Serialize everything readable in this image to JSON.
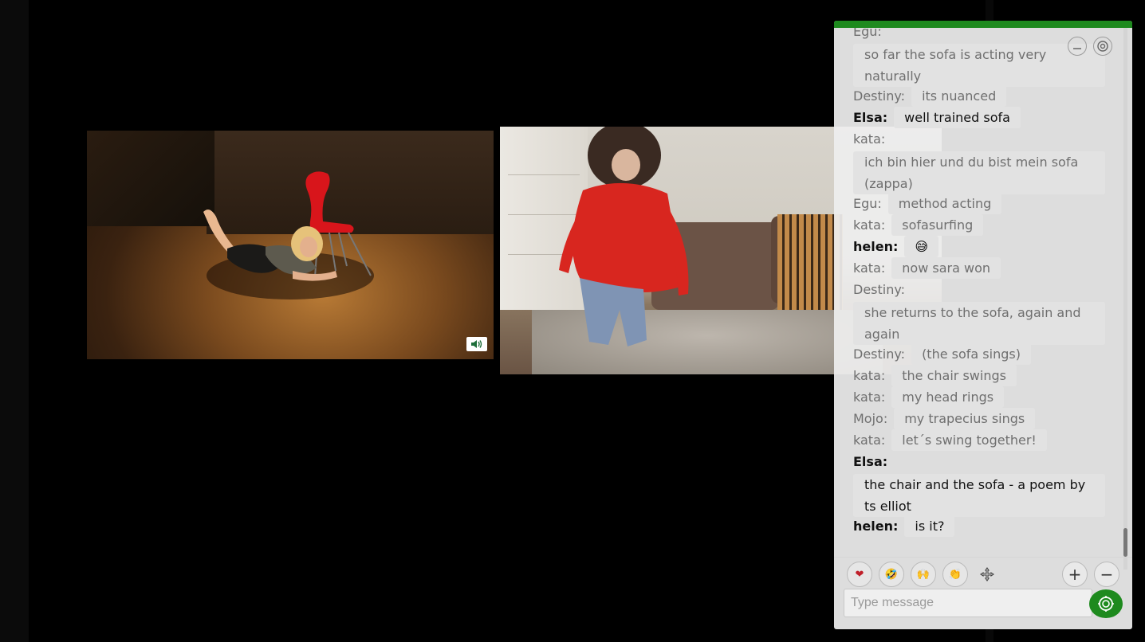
{
  "chat": {
    "messages": [
      {
        "user": "Egu:",
        "text": "so far the sofa is acting very naturally",
        "bold": false
      },
      {
        "user": "Destiny:",
        "text": "its nuanced",
        "bold": false
      },
      {
        "user": "Elsa:",
        "text": "well trained sofa",
        "bold": true
      },
      {
        "user": "kata:",
        "text": "ich bin hier und du bist mein sofa (zappa)",
        "bold": false
      },
      {
        "user": "Egu:",
        "text": "method acting",
        "bold": false
      },
      {
        "user": "kata:",
        "text": "sofasurfing",
        "bold": false
      },
      {
        "user": "helen:",
        "text": "😅",
        "bold": true
      },
      {
        "user": "kata:",
        "text": "now sara won",
        "bold": false
      },
      {
        "user": "Destiny:",
        "text": "she returns to the sofa, again and again",
        "bold": false
      },
      {
        "user": "Destiny:",
        "text": "(the sofa sings)",
        "bold": false
      },
      {
        "user": "kata:",
        "text": "the chair swings",
        "bold": false
      },
      {
        "user": "kata:",
        "text": "my head rings",
        "bold": false
      },
      {
        "user": "Mojo:",
        "text": "my trapecius sings",
        "bold": false
      },
      {
        "user": "kata:",
        "text": "let´s swing together!",
        "bold": false
      },
      {
        "user": "Elsa:",
        "text": "the chair and the sofa - a poem by ts elliot",
        "bold": true
      },
      {
        "user": "helen:",
        "text": "is it?",
        "bold": true
      }
    ],
    "reactions": [
      {
        "name": "heart",
        "glyph": "❤"
      },
      {
        "name": "laugh",
        "glyph": "🤣"
      },
      {
        "name": "raised-hands",
        "glyph": "🙌"
      },
      {
        "name": "clap",
        "glyph": "👏"
      }
    ],
    "input": {
      "placeholder": "Type message",
      "value": ""
    },
    "zoom_in_label": "+",
    "zoom_out_label": "−",
    "icons": {
      "minimize": "minimize-icon",
      "settings": "settings-icon",
      "move": "move-icon",
      "send": "send-icon"
    },
    "accent_color": "#1e8a1e"
  },
  "videos": {
    "left": {
      "audio_icon": "speaker-icon"
    },
    "right": {}
  }
}
